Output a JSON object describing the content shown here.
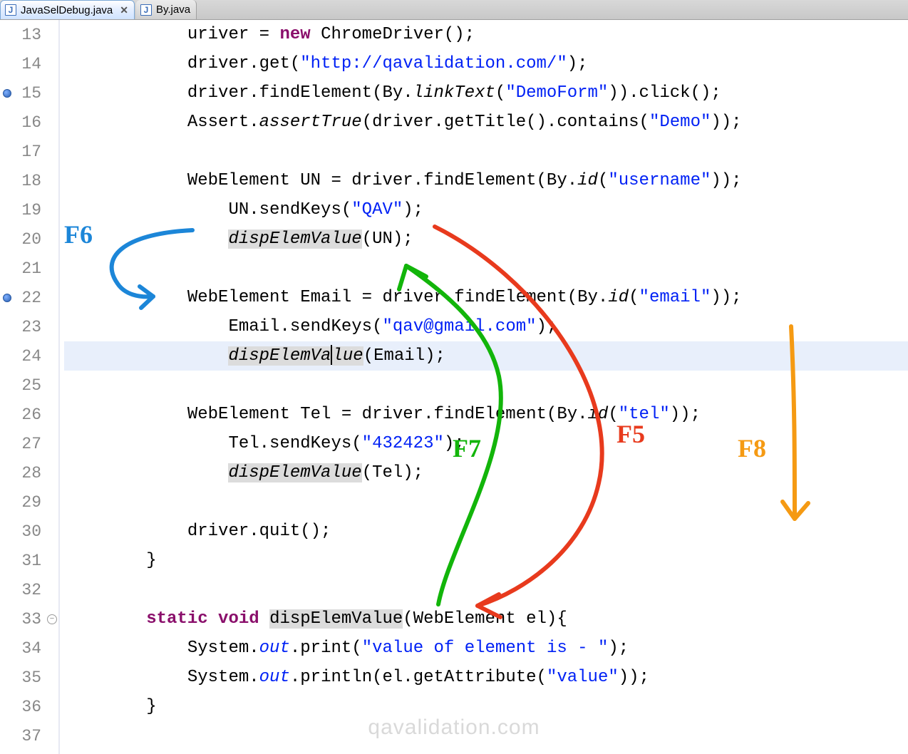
{
  "tabs": [
    {
      "label": "JavaSelDebug.java",
      "active": true
    },
    {
      "label": "By.java",
      "active": false
    }
  ],
  "annotations": {
    "f6": "F6",
    "f7": "F7",
    "f5": "F5",
    "f8": "F8"
  },
  "watermark": "qavalidation.com",
  "lines": [
    {
      "n": 13,
      "bp": false,
      "fold": "",
      "hl": false,
      "segments": [
        {
          "cls": "",
          "t": "            uriver = "
        },
        {
          "cls": "kw",
          "t": "new"
        },
        {
          "cls": "",
          "t": " ChromeDriver();"
        }
      ]
    },
    {
      "n": 14,
      "bp": false,
      "fold": "",
      "hl": false,
      "segments": [
        {
          "cls": "",
          "t": "            driver.get("
        },
        {
          "cls": "str",
          "t": "\"http://qavalidation.com/\""
        },
        {
          "cls": "",
          "t": ");"
        }
      ]
    },
    {
      "n": 15,
      "bp": true,
      "fold": "",
      "hl": false,
      "segments": [
        {
          "cls": "",
          "t": "            driver.findElement(By."
        },
        {
          "cls": "method-it",
          "t": "linkText"
        },
        {
          "cls": "",
          "t": "("
        },
        {
          "cls": "str",
          "t": "\"DemoForm\""
        },
        {
          "cls": "",
          "t": ")).click();"
        }
      ]
    },
    {
      "n": 16,
      "bp": false,
      "fold": "",
      "hl": false,
      "segments": [
        {
          "cls": "",
          "t": "            Assert."
        },
        {
          "cls": "method-it",
          "t": "assertTrue"
        },
        {
          "cls": "",
          "t": "(driver.getTitle().contains("
        },
        {
          "cls": "str",
          "t": "\"Demo\""
        },
        {
          "cls": "",
          "t": "));"
        }
      ]
    },
    {
      "n": 17,
      "bp": false,
      "fold": "",
      "hl": false,
      "segments": [
        {
          "cls": "",
          "t": ""
        }
      ]
    },
    {
      "n": 18,
      "bp": false,
      "fold": "",
      "hl": false,
      "segments": [
        {
          "cls": "",
          "t": "            WebElement UN = driver.findElement(By."
        },
        {
          "cls": "method-it",
          "t": "id"
        },
        {
          "cls": "",
          "t": "("
        },
        {
          "cls": "str",
          "t": "\"username\""
        },
        {
          "cls": "",
          "t": "));"
        }
      ]
    },
    {
      "n": 19,
      "bp": false,
      "fold": "",
      "hl": false,
      "segments": [
        {
          "cls": "",
          "t": "                UN.sendKeys("
        },
        {
          "cls": "str",
          "t": "\"QAV\""
        },
        {
          "cls": "",
          "t": ");"
        }
      ]
    },
    {
      "n": 20,
      "bp": false,
      "fold": "",
      "hl": false,
      "segments": [
        {
          "cls": "",
          "t": "                "
        },
        {
          "cls": "hlspan method-it",
          "t": "dispElemValue"
        },
        {
          "cls": "",
          "t": "(UN);"
        }
      ]
    },
    {
      "n": 21,
      "bp": false,
      "fold": "",
      "hl": false,
      "segments": [
        {
          "cls": "",
          "t": ""
        }
      ]
    },
    {
      "n": 22,
      "bp": true,
      "fold": "",
      "hl": false,
      "segments": [
        {
          "cls": "",
          "t": "            WebElement Email = driver.findElement(By."
        },
        {
          "cls": "method-it",
          "t": "id"
        },
        {
          "cls": "",
          "t": "("
        },
        {
          "cls": "str",
          "t": "\"email\""
        },
        {
          "cls": "",
          "t": "));"
        }
      ]
    },
    {
      "n": 23,
      "bp": false,
      "fold": "",
      "hl": false,
      "segments": [
        {
          "cls": "",
          "t": "                Email.sendKeys("
        },
        {
          "cls": "str",
          "t": "\"qav@gmail.com\""
        },
        {
          "cls": "",
          "t": ");"
        }
      ]
    },
    {
      "n": 24,
      "bp": false,
      "fold": "",
      "hl": true,
      "segments": [
        {
          "cls": "",
          "t": "                "
        },
        {
          "cls": "hlspan method-it",
          "t": "dispElemVa"
        },
        {
          "cls": "caret",
          "t": ""
        },
        {
          "cls": "hlspan method-it",
          "t": "lue"
        },
        {
          "cls": "",
          "t": "(Email);"
        }
      ]
    },
    {
      "n": 25,
      "bp": false,
      "fold": "",
      "hl": false,
      "segments": [
        {
          "cls": "",
          "t": ""
        }
      ]
    },
    {
      "n": 26,
      "bp": false,
      "fold": "",
      "hl": false,
      "segments": [
        {
          "cls": "",
          "t": "            WebElement Tel = driver.findElement(By."
        },
        {
          "cls": "method-it",
          "t": "id"
        },
        {
          "cls": "",
          "t": "("
        },
        {
          "cls": "str",
          "t": "\"tel\""
        },
        {
          "cls": "",
          "t": "));"
        }
      ]
    },
    {
      "n": 27,
      "bp": false,
      "fold": "",
      "hl": false,
      "segments": [
        {
          "cls": "",
          "t": "                Tel.sendKeys("
        },
        {
          "cls": "str",
          "t": "\"432423\""
        },
        {
          "cls": "",
          "t": ");"
        }
      ]
    },
    {
      "n": 28,
      "bp": false,
      "fold": "",
      "hl": false,
      "segments": [
        {
          "cls": "",
          "t": "                "
        },
        {
          "cls": "hlspan method-it",
          "t": "dispElemValue"
        },
        {
          "cls": "",
          "t": "(Tel);"
        }
      ]
    },
    {
      "n": 29,
      "bp": false,
      "fold": "",
      "hl": false,
      "segments": [
        {
          "cls": "",
          "t": ""
        }
      ]
    },
    {
      "n": 30,
      "bp": false,
      "fold": "",
      "hl": false,
      "segments": [
        {
          "cls": "",
          "t": "            driver.quit();"
        }
      ]
    },
    {
      "n": 31,
      "bp": false,
      "fold": "",
      "hl": false,
      "segments": [
        {
          "cls": "",
          "t": "        }"
        }
      ]
    },
    {
      "n": 32,
      "bp": false,
      "fold": "",
      "hl": false,
      "segments": [
        {
          "cls": "",
          "t": ""
        }
      ]
    },
    {
      "n": 33,
      "bp": false,
      "fold": "minus",
      "hl": false,
      "segments": [
        {
          "cls": "",
          "t": "        "
        },
        {
          "cls": "kw",
          "t": "static"
        },
        {
          "cls": "",
          "t": " "
        },
        {
          "cls": "kw",
          "t": "void"
        },
        {
          "cls": "",
          "t": " "
        },
        {
          "cls": "hlspan",
          "t": "dispElemValue"
        },
        {
          "cls": "",
          "t": "(WebElement el){"
        }
      ]
    },
    {
      "n": 34,
      "bp": false,
      "fold": "",
      "hl": false,
      "segments": [
        {
          "cls": "",
          "t": "            System."
        },
        {
          "cls": "static-it",
          "t": "out"
        },
        {
          "cls": "",
          "t": ".print("
        },
        {
          "cls": "str",
          "t": "\"value of element is - \""
        },
        {
          "cls": "",
          "t": ");"
        }
      ]
    },
    {
      "n": 35,
      "bp": false,
      "fold": "",
      "hl": false,
      "segments": [
        {
          "cls": "",
          "t": "            System."
        },
        {
          "cls": "static-it",
          "t": "out"
        },
        {
          "cls": "",
          "t": ".println(el.getAttribute("
        },
        {
          "cls": "str",
          "t": "\"value\""
        },
        {
          "cls": "",
          "t": "));"
        }
      ]
    },
    {
      "n": 36,
      "bp": false,
      "fold": "",
      "hl": false,
      "segments": [
        {
          "cls": "",
          "t": "        }"
        }
      ]
    },
    {
      "n": 37,
      "bp": false,
      "fold": "",
      "hl": false,
      "segments": [
        {
          "cls": "",
          "t": ""
        }
      ]
    }
  ]
}
